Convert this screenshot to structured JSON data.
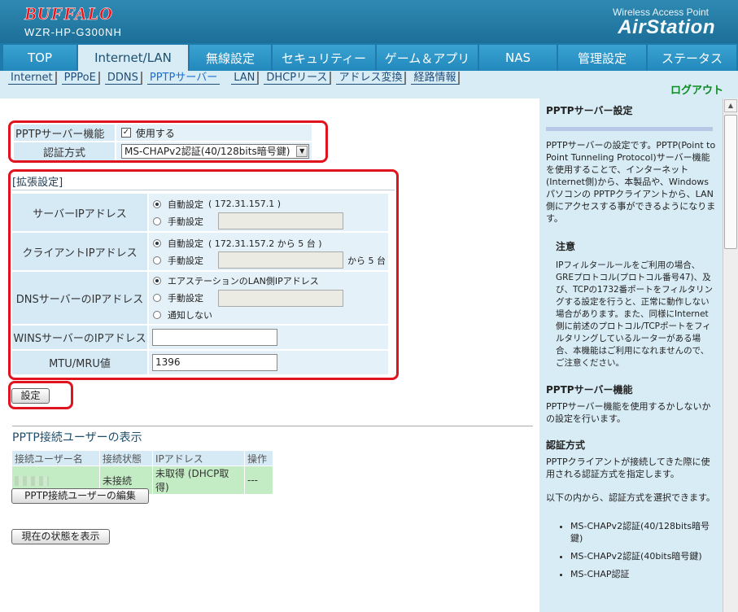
{
  "header": {
    "brand": "BUFFALO",
    "model": "WZR-HP-G300NH",
    "tagline": "Wireless Access Point",
    "product": "AirStation"
  },
  "tabs": [
    {
      "label": "TOP"
    },
    {
      "label": "Internet/LAN",
      "active": true
    },
    {
      "label": "無線設定"
    },
    {
      "label": "セキュリティー"
    },
    {
      "label": "ゲーム＆アプリ"
    },
    {
      "label": "NAS"
    },
    {
      "label": "管理設定"
    },
    {
      "label": "ステータス"
    }
  ],
  "subtabs": [
    {
      "label": "Internet"
    },
    {
      "label": "PPPoE"
    },
    {
      "label": "DDNS"
    },
    {
      "label": "PPTPサーバー",
      "active": true
    },
    {
      "label": "LAN"
    },
    {
      "label": "DHCPリース"
    },
    {
      "label": "アドレス変換"
    },
    {
      "label": "経路情報"
    }
  ],
  "logout": "ログアウト",
  "basic": {
    "pptp_label": "PPTPサーバー機能",
    "pptp_check": "使用する",
    "pptp_checked": true,
    "auth_label": "認証方式",
    "auth_value": "MS-CHAPv2認証(40/128bits暗号鍵)"
  },
  "extended": {
    "title": "[拡張設定]",
    "server_ip_label": "サーバーIPアドレス",
    "server_ip_auto": "自動設定",
    "server_ip_auto_note": "( 172.31.157.1 )",
    "server_ip_manual": "手動設定",
    "client_ip_label": "クライアントIPアドレス",
    "client_ip_auto": "自動設定",
    "client_ip_auto_note": "( 172.31.157.2 から 5 台 )",
    "client_ip_manual": "手動設定",
    "client_ip_suffix": "から 5 台",
    "dns_label": "DNSサーバーのIPアドレス",
    "dns_opt1": "エアステーションのLAN側IPアドレス",
    "dns_opt2": "手動設定",
    "dns_opt3": "通知しない",
    "wins_label": "WINSサーバーのIPアドレス",
    "wins_value": "",
    "mtu_label": "MTU/MRU値",
    "mtu_value": "1396"
  },
  "buttons": {
    "submit": "設定",
    "edit_users": "PPTP接続ユーザーの編集",
    "show_status": "現在の状態を表示"
  },
  "users": {
    "title": "PPTP接続ユーザーの表示",
    "headers": [
      "接続ユーザー名",
      "接続状態",
      "IPアドレス",
      "操作"
    ],
    "rows": [
      [
        "",
        "未接続",
        "未取得 (DHCP取得)",
        "---"
      ]
    ]
  },
  "help": {
    "title": "PPTPサーバー設定",
    "intro": "PPTPサーバーの設定です。PPTP(Point to Point Tunneling Protocol)サーバー機能を使用することで、インターネット(Internet側)から、本製品や、Windowsパソコンの PPTPクライアントから、LAN側にアクセスする事ができるようになります。",
    "note_title": "注意",
    "note_text": "IPフィルタールールをご利用の場合、GREプロトコル(プロトコル番号47)、及び、TCPの1732番ポートをフィルタリングする設定を行うと、正常に動作しない場合があります。また、同様にInternet側に前述のプロトコル/TCPポートをフィルタリングしているルーターがある場合、本機能はご利用になれませんので、ご注意ください。",
    "sec1_title": "PPTPサーバー機能",
    "sec1_text": "PPTPサーバー機能を使用するかしないかの設定を行います。",
    "sec2_title": "認証方式",
    "sec2_text": "PPTPクライアントが接続してきた際に使用される認証方式を指定します。",
    "sec2_text2": "以下の内から、認証方式を選択できます。",
    "auth_options": [
      "MS-CHAPv2認証(40/128bits暗号鍵)",
      "MS-CHAPv2認証(40bits暗号鍵)",
      "MS-CHAP認証"
    ]
  },
  "colors": {
    "accent": "#1e7bab",
    "highlight_box": "#e0141e",
    "logout": "#0b8a22"
  }
}
